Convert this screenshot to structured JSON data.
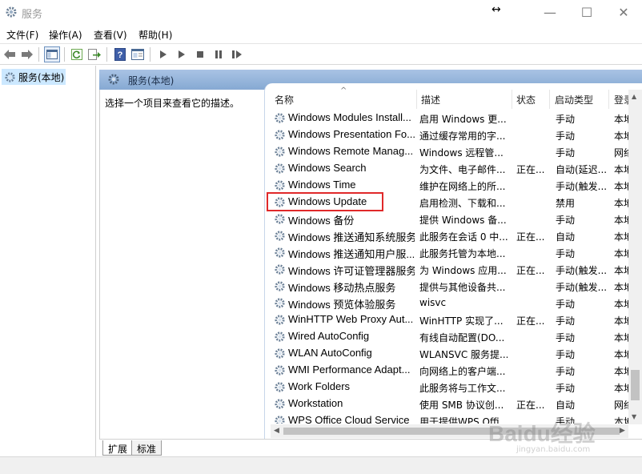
{
  "window": {
    "title": "服务",
    "buttons": {
      "minimize": "—",
      "maximize": "☐",
      "close": "✕"
    },
    "resize_glyph": "↔"
  },
  "menu": [
    "文件(F)",
    "操作(A)",
    "查看(V)",
    "帮助(H)"
  ],
  "toolbar": [
    "back-arrow-icon",
    "forward-arrow-icon",
    "console-tree-icon",
    "refresh-icon",
    "export-list-icon",
    "help-icon",
    "properties-icon",
    "play-icon",
    "play-alt-icon",
    "stop-icon",
    "pause-icon",
    "resume-icon"
  ],
  "tree": {
    "selected_label": "服务(本地)"
  },
  "panel": {
    "header": "服务(本地)",
    "description": "选择一个项目来查看它的描述。"
  },
  "columns": {
    "name": "名称",
    "desc": "描述",
    "status": "状态",
    "start": "启动类型",
    "logon": "登录"
  },
  "services": [
    {
      "name": "Windows Modules Install...",
      "desc": "启用 Windows 更...",
      "status": "",
      "start": "手动",
      "logon": "本地"
    },
    {
      "name": "Windows Presentation Fo...",
      "desc": "通过缓存常用的字...",
      "status": "",
      "start": "手动",
      "logon": "本地"
    },
    {
      "name": "Windows Remote Manag...",
      "desc": "Windows 远程管...",
      "status": "",
      "start": "手动",
      "logon": "网络"
    },
    {
      "name": "Windows Search",
      "desc": "为文件、电子邮件...",
      "status": "正在...",
      "start": "自动(延迟...",
      "logon": "本地"
    },
    {
      "name": "Windows Time",
      "desc": "维护在网络上的所...",
      "status": "",
      "start": "手动(触发...",
      "logon": "本地"
    },
    {
      "name": "Windows Update",
      "desc": "启用检测、下载和...",
      "status": "",
      "start": "禁用",
      "logon": "本地"
    },
    {
      "name": "Windows 备份",
      "desc": "提供 Windows 备...",
      "status": "",
      "start": "手动",
      "logon": "本地"
    },
    {
      "name": "Windows 推送通知系统服务",
      "desc": "此服务在会话 0 中...",
      "status": "正在...",
      "start": "自动",
      "logon": "本地"
    },
    {
      "name": "Windows 推送通知用户服...",
      "desc": "此服务托管为本地...",
      "status": "",
      "start": "手动",
      "logon": "本地"
    },
    {
      "name": "Windows 许可证管理器服务",
      "desc": "为 Windows 应用...",
      "status": "正在...",
      "start": "手动(触发...",
      "logon": "本地"
    },
    {
      "name": "Windows 移动热点服务",
      "desc": "提供与其他设备共...",
      "status": "",
      "start": "手动(触发...",
      "logon": "本地"
    },
    {
      "name": "Windows 预览体验服务",
      "desc": "wisvc",
      "status": "",
      "start": "手动",
      "logon": "本地"
    },
    {
      "name": "WinHTTP Web Proxy Aut...",
      "desc": "WinHTTP 实现了...",
      "status": "正在...",
      "start": "手动",
      "logon": "本地"
    },
    {
      "name": "Wired AutoConfig",
      "desc": "有线自动配置(DO...",
      "status": "",
      "start": "手动",
      "logon": "本地"
    },
    {
      "name": "WLAN AutoConfig",
      "desc": "WLANSVC 服务提...",
      "status": "",
      "start": "手动",
      "logon": "本地"
    },
    {
      "name": "WMI Performance Adapt...",
      "desc": "向网络上的客户端...",
      "status": "",
      "start": "手动",
      "logon": "本地"
    },
    {
      "name": "Work Folders",
      "desc": "此服务将与工作文...",
      "status": "",
      "start": "手动",
      "logon": "本地"
    },
    {
      "name": "Workstation",
      "desc": "使用 SMB 协议创...",
      "status": "正在...",
      "start": "自动",
      "logon": "网络"
    },
    {
      "name": "WPS Office Cloud Service",
      "desc": "用于提供WPS Offi...",
      "status": "",
      "start": "手动",
      "logon": "本地"
    }
  ],
  "highlighted_service": "Windows Update",
  "tabs": [
    "扩展",
    "标准"
  ],
  "watermark": {
    "main": "Baidu经验",
    "sub": "jingyan.baidu.com"
  },
  "colors": {
    "header_blue": "#8baed8",
    "selection": "#cce8ff",
    "highlight_border": "#e0292a"
  }
}
